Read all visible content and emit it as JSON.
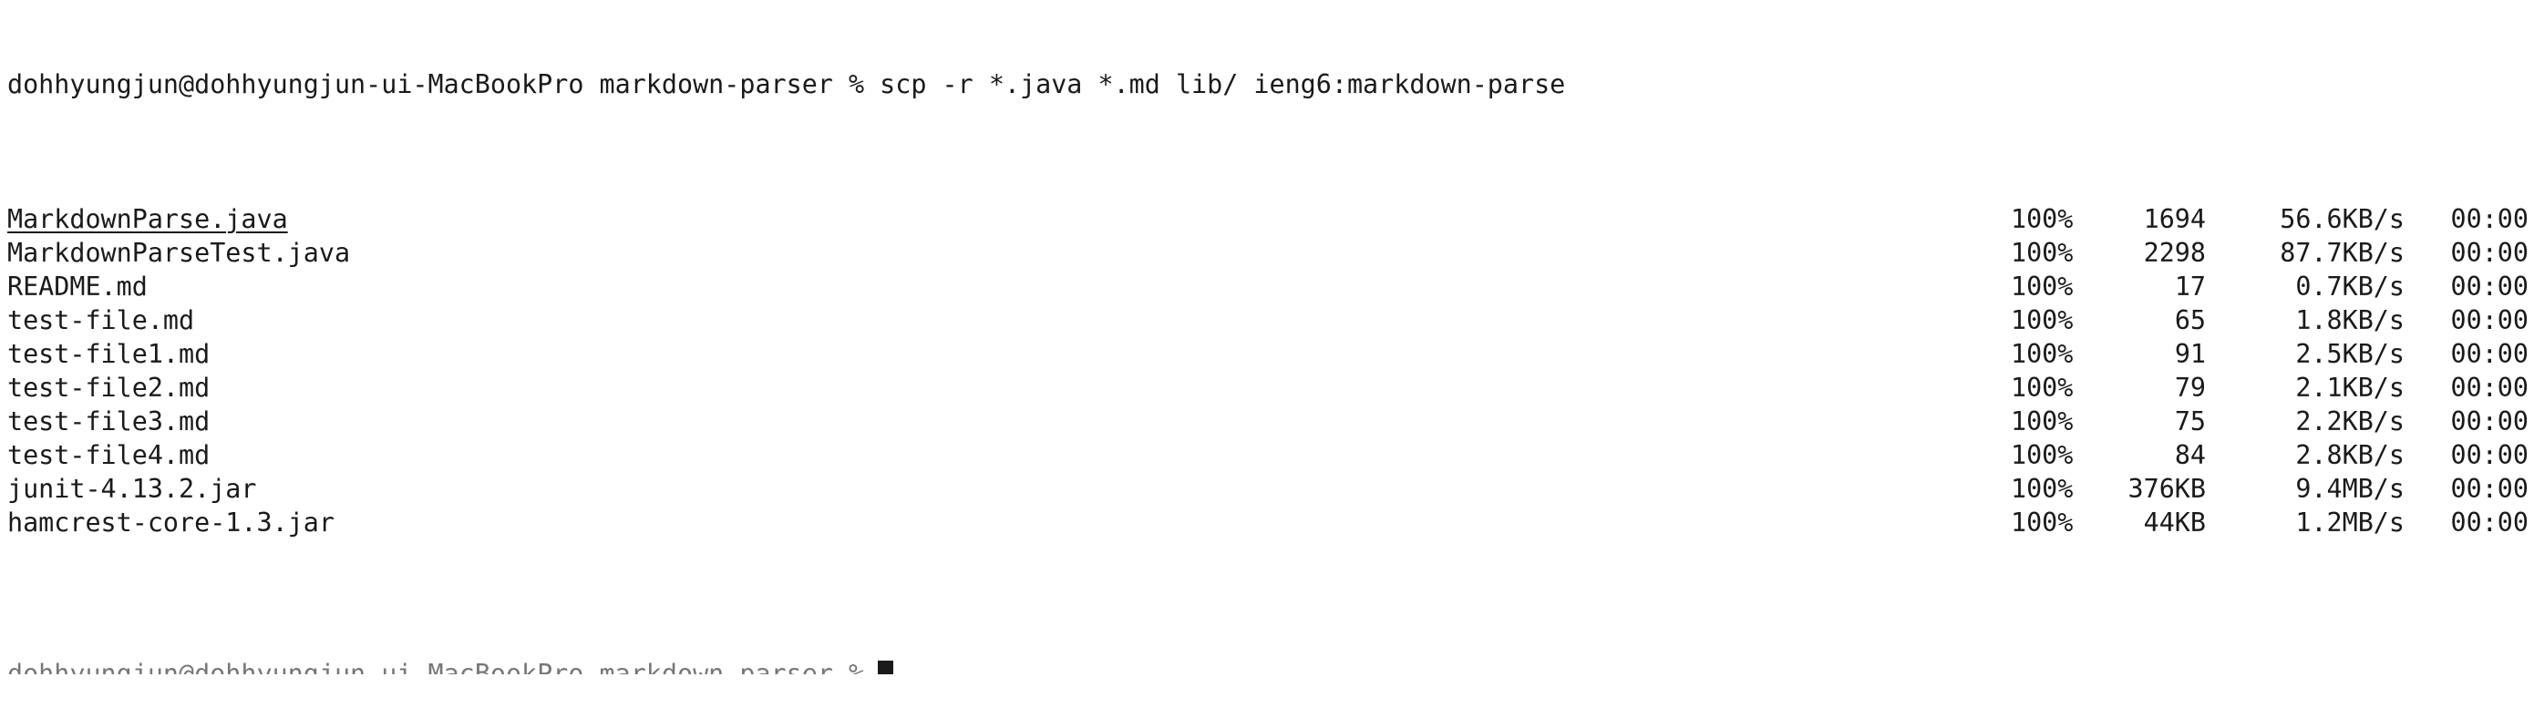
{
  "terminal": {
    "command_line": "dohhyungjun@dohhyungjun-ui-MacBookPro markdown-parser % scp -r *.java *.md lib/ ieng6:markdown-parse",
    "next_prompt": "dohhyungjun@dohhyungjun-ui-MacBookPro markdown-parser %",
    "rows": [
      {
        "file": "MarkdownParse.java",
        "pct": "100%",
        "size": "1694",
        "rate": "56.6KB/s",
        "time": "00:00"
      },
      {
        "file": "MarkdownParseTest.java",
        "pct": "100%",
        "size": "2298",
        "rate": "87.7KB/s",
        "time": "00:00"
      },
      {
        "file": "README.md",
        "pct": "100%",
        "size": "17",
        "rate": "0.7KB/s",
        "time": "00:00"
      },
      {
        "file": "test-file.md",
        "pct": "100%",
        "size": "65",
        "rate": "1.8KB/s",
        "time": "00:00"
      },
      {
        "file": "test-file1.md",
        "pct": "100%",
        "size": "91",
        "rate": "2.5KB/s",
        "time": "00:00"
      },
      {
        "file": "test-file2.md",
        "pct": "100%",
        "size": "79",
        "rate": "2.1KB/s",
        "time": "00:00"
      },
      {
        "file": "test-file3.md",
        "pct": "100%",
        "size": "75",
        "rate": "2.2KB/s",
        "time": "00:00"
      },
      {
        "file": "test-file4.md",
        "pct": "100%",
        "size": "84",
        "rate": "2.8KB/s",
        "time": "00:00"
      },
      {
        "file": "junit-4.13.2.jar",
        "pct": "100%",
        "size": "376KB",
        "rate": "9.4MB/s",
        "time": "00:00"
      },
      {
        "file": "hamcrest-core-1.3.jar",
        "pct": "100%",
        "size": "44KB",
        "rate": "1.2MB/s",
        "time": "00:00"
      }
    ]
  },
  "colors": {
    "background": "#ffffff",
    "text": "#1a1a1a"
  }
}
